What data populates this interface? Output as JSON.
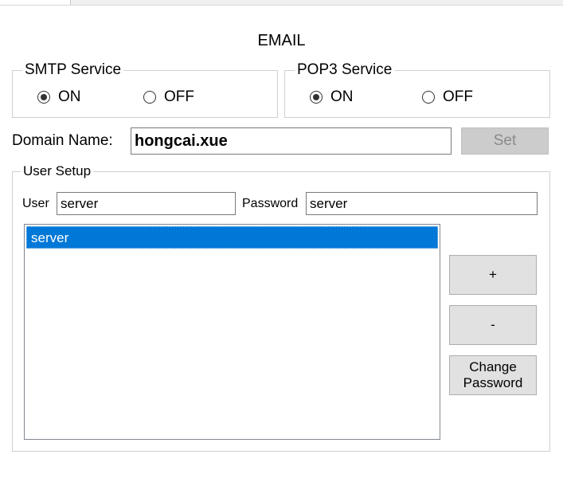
{
  "title": "EMAIL",
  "smtp": {
    "legend": "SMTP Service",
    "on_label": "ON",
    "off_label": "OFF",
    "selected": "ON"
  },
  "pop3": {
    "legend": "POP3 Service",
    "on_label": "ON",
    "off_label": "OFF",
    "selected": "ON"
  },
  "domain": {
    "label": "Domain Name:",
    "value": "hongcai.xue",
    "set_label": "Set"
  },
  "user_setup": {
    "legend": "User Setup",
    "user_label": "User",
    "user_value": "server",
    "password_label": "Password",
    "password_value": "server",
    "users": [
      "server"
    ],
    "selected_user": "server",
    "add_label": "+",
    "remove_label": "-",
    "change_password_line1": "Change",
    "change_password_line2": "Password"
  }
}
